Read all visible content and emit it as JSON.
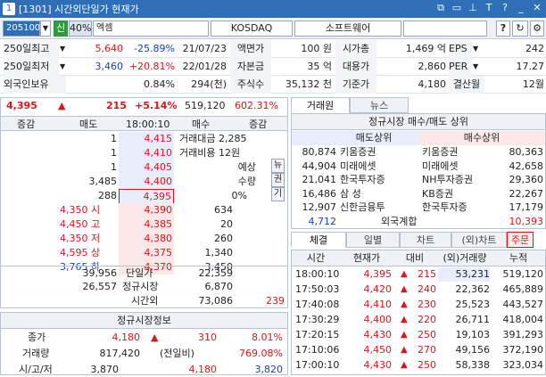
{
  "window": {
    "title": "[1301] 시간외단일가 현재가",
    "badge": "1"
  },
  "toolbar": {
    "code": "205100",
    "sin": "신",
    "margin": "40%",
    "name": "엑셈",
    "market": "KOSDAQ",
    "sector": "소프트웨어",
    "help": "?"
  },
  "info": {
    "r1": {
      "l1": "250일최고",
      "v1": "5,640",
      "p1": "-25.89%",
      "d1": "21/07/23",
      "l2": "액면가",
      "v2": "100 원",
      "l3": "시가총",
      "v3": "1,469 억",
      "l4": "EPS",
      "v4": "242"
    },
    "r2": {
      "l1": "250일최저",
      "v1": "3,460",
      "p1": "+20.81%",
      "d1": "22/01/28",
      "l2": "자본금",
      "v2": "35 억",
      "l3": "대용가",
      "v3": "2,860",
      "l4": "PER",
      "v4": "17.27"
    },
    "r3": {
      "l1": "외국인보유",
      "p1": "0.84%",
      "d1": "294(천)",
      "l2": "주식수",
      "v2": "35,132 천",
      "l3": "기준가",
      "v3": "4,180",
      "l4": "결산월",
      "v4": "12월"
    }
  },
  "quote": {
    "price": "4,395",
    "arrow": "▲",
    "change": "215",
    "rate": "+5.14%",
    "volume": "519,120",
    "vrate": "602.31%",
    "h_chg": "증감",
    "h_ask": "매도",
    "time": "18:00:10",
    "h_bid": "매수",
    "h_chg2": "증감",
    "asks": [
      {
        "qty": "1",
        "price": "4,415"
      },
      {
        "qty": "1",
        "price": "4,410"
      },
      {
        "qty": "1",
        "price": "4,405"
      },
      {
        "qty": "3,485",
        "price": "4,400"
      },
      {
        "qty": "288",
        "price": "4,395"
      }
    ],
    "bids": [
      {
        "price": "4,390",
        "qty": "634"
      },
      {
        "price": "4,385",
        "qty": "20"
      },
      {
        "price": "4,380",
        "qty": "260"
      },
      {
        "price": "4,375",
        "qty": "1,340"
      },
      {
        "price": "4,370",
        "qty": "3,450"
      }
    ],
    "stats": [
      {
        "l": "4,350 시"
      },
      {
        "l": "4,450 고"
      },
      {
        "l": "4,350 저"
      },
      {
        "l": "4,595 상"
      },
      {
        "l": "3,765 하"
      }
    ],
    "tradeamt": "거래대금 2,285",
    "tradecost": "거래비용 12원",
    "exp_l": "예상",
    "exp_q": "수량",
    "exp_p": "0%",
    "side": [
      "뉴",
      "권",
      "기"
    ],
    "tot_ask": "39,956",
    "tot_bid": "22,359",
    "lbl_single": "단일가",
    "reg_ask": "26,557",
    "reg_bid": "6,870",
    "lbl_reg": "정규시장",
    "lbl_after": "시간외",
    "after_v": "73,086",
    "after_v2": "239"
  },
  "regular": {
    "title": "정규시장정보",
    "r1": {
      "l": "종가",
      "v": "4,180",
      "a": "▲",
      "c": "310",
      "p": "8.01%"
    },
    "r2": {
      "l": "거래량",
      "v": "817,420",
      "m": "(전일비)",
      "p": "769.08%"
    },
    "r3": {
      "l": "시/고/저",
      "v1": "3,870",
      "v2": "4,180",
      "v3": "3,820"
    }
  },
  "rank": {
    "tabs": [
      "거래원",
      "뉴스"
    ],
    "title": "정규시장 매수/매도 상위",
    "h_sell": "매도상위",
    "h_buy": "매수상위",
    "rows": [
      {
        "sq": "80,874",
        "sn": "키움증권",
        "bn": "키움증권",
        "bq": "80,363"
      },
      {
        "sq": "44,904",
        "sn": "미래에셋",
        "bn": "미래에셋",
        "bq": "42,658"
      },
      {
        "sq": "21,041",
        "sn": "한국투자증",
        "bn": "NH투자증권",
        "bq": "29,360"
      },
      {
        "sq": "16,486",
        "sn": "삼  성",
        "bn": "KB증권",
        "bq": "22,267"
      },
      {
        "sq": "12,907",
        "sn": "신한금융투",
        "bn": "한국투자증",
        "bq": "17,179"
      }
    ],
    "foreign": {
      "sq": "4,712",
      "l": "외국계합",
      "bq": "10,393"
    }
  },
  "trades": {
    "tabs": [
      "체결",
      "일별",
      "차트",
      "(외)차트"
    ],
    "order": "주문",
    "headers": [
      "시간",
      "현재가",
      "대비",
      "(외)거래량",
      "누적"
    ],
    "rows": [
      {
        "t": "18:00:10",
        "p": "4,395",
        "c": "215",
        "v": "53,231",
        "acc": "519,120"
      },
      {
        "t": "17:50:03",
        "p": "4,420",
        "c": "240",
        "v": "22,362",
        "acc": "465,889"
      },
      {
        "t": "17:40:08",
        "p": "4,410",
        "c": "230",
        "v": "25,523",
        "acc": "443,527"
      },
      {
        "t": "17:30:29",
        "p": "4,400",
        "c": "220",
        "v": "26,711",
        "acc": "418,004"
      },
      {
        "t": "17:20:15",
        "p": "4,430",
        "c": "250",
        "v": "19,103",
        "acc": "391,293"
      },
      {
        "t": "17:10:06",
        "p": "4,450",
        "c": "270",
        "v": "49,156",
        "acc": "372,190"
      },
      {
        "t": "17:00:10",
        "p": "4,430",
        "c": "250",
        "v": "58,338",
        "acc": "323,034"
      }
    ]
  }
}
